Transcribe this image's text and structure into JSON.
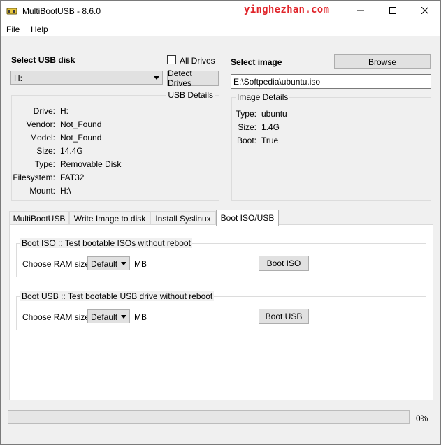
{
  "window": {
    "title": "MultiBootUSB - 8.6.0",
    "watermark": "yinghezhan.com"
  },
  "menu": [
    "File",
    "Help"
  ],
  "usb": {
    "select_label": "Select USB disk",
    "all_drives_label": "All Drives",
    "all_drives_checked": false,
    "disk_value": "H:",
    "detect_button": "Detect Drives",
    "details_title": "USB Details",
    "details": [
      {
        "key": "Drive:",
        "value": "H:"
      },
      {
        "key": "Vendor:",
        "value": "Not_Found"
      },
      {
        "key": "Model:",
        "value": "Not_Found"
      },
      {
        "key": "Size:",
        "value": "14.4G"
      },
      {
        "key": "Type:",
        "value": "Removable Disk"
      },
      {
        "key": "Filesystem:",
        "value": "FAT32"
      },
      {
        "key": "Mount:",
        "value": "H:\\"
      }
    ]
  },
  "image": {
    "select_label": "Select image",
    "browse_button": "Browse",
    "path_value": "E:\\Softpedia\\ubuntu.iso",
    "details_title": "Image Details",
    "details": [
      {
        "key": "Type:",
        "value": "ubuntu"
      },
      {
        "key": "Size:",
        "value": "1.4G"
      },
      {
        "key": "Boot:",
        "value": "True"
      }
    ]
  },
  "tabs": [
    {
      "label": "MultiBootUSB",
      "active": false
    },
    {
      "label": "Write Image to disk",
      "active": false
    },
    {
      "label": "Install Syslinux",
      "active": false
    },
    {
      "label": "Boot ISO/USB",
      "active": true
    }
  ],
  "boot_iso": {
    "title": "Boot ISO :: Test bootable ISOs without reboot",
    "ram_label": "Choose RAM size:",
    "ram_value": "Default",
    "unit": "MB",
    "button": "Boot ISO"
  },
  "boot_usb": {
    "title": "Boot USB :: Test bootable USB drive without reboot",
    "ram_label": "Choose RAM size:",
    "ram_value": "Default",
    "unit": "MB",
    "button": "Boot USB"
  },
  "progress": {
    "value": 0,
    "label": "0%",
    "fill_color": "#06b025"
  }
}
